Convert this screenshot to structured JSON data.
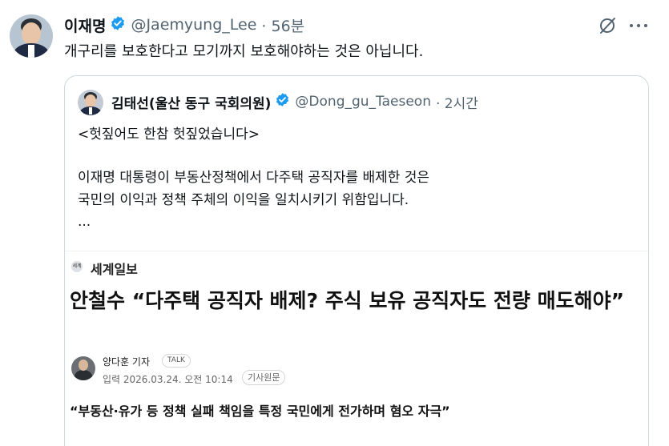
{
  "tweet": {
    "author_name": "이재명",
    "author_handle": "@Jaemyung_Lee",
    "time": "· 56분",
    "text": "개구리를 보호한다고 모기까지 보호해야하는 것은 아닙니다."
  },
  "quote": {
    "author_name": "김태선(울산 동구 국회의원)",
    "author_handle": "@Dong_gu_Taeseon",
    "time": "· 2시간",
    "line1": "<헛짚어도 한참 헛짚었습니다>",
    "line2": "이재명 대통령이 부동산정책에서 다주택 공직자를 배제한 것은",
    "line3": "국민의 이익과 정책 주체의 이익을 일치시키기 위함입니다.",
    "line4": "..."
  },
  "news": {
    "logo_text": "세계",
    "source": "세계일보",
    "headline": "안철수 “다주택 공직자 배제? 주식 보유 공직자도 전량 매도해야”",
    "reporter": "양다훈 기자",
    "talk_badge": "TALK",
    "date": "입력 2026.03.24. 오전 10:14",
    "original_badge": "기사원문",
    "subtitle": "“부동산·유가 등 정책 실패 책임을 특정 국민에게 전가하며 혐오 자극”"
  },
  "icons": {
    "verified": "verified-badge-icon",
    "grok": "grok-icon",
    "more": "more-options-icon"
  },
  "colors": {
    "verified": "#1d9bf0",
    "text_primary": "#0f1419",
    "text_secondary": "#536471",
    "border": "#cfd9de"
  }
}
